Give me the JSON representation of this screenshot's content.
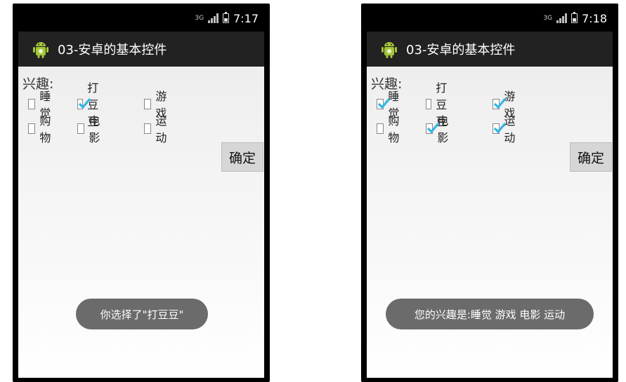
{
  "left": {
    "status": {
      "network": "3G",
      "time": "7:17"
    },
    "app_title": "03-安卓的基本控件",
    "interest_label": "兴趣:",
    "checkboxes": [
      {
        "label": "睡觉",
        "checked": false
      },
      {
        "label": "打豆豆",
        "checked": true
      },
      {
        "label": "游戏",
        "checked": false
      },
      {
        "label": "购物",
        "checked": false
      },
      {
        "label": "电影",
        "checked": false
      },
      {
        "label": "运动",
        "checked": false
      }
    ],
    "ok_button": "确定",
    "toast": "你选择了\"打豆豆\""
  },
  "right": {
    "status": {
      "network": "3G",
      "time": "7:18"
    },
    "app_title": "03-安卓的基本控件",
    "interest_label": "兴趣:",
    "checkboxes": [
      {
        "label": "睡觉",
        "checked": true
      },
      {
        "label": "打豆豆",
        "checked": false
      },
      {
        "label": "游戏",
        "checked": true
      },
      {
        "label": "购物",
        "checked": false
      },
      {
        "label": "电影",
        "checked": true
      },
      {
        "label": "运动",
        "checked": true
      }
    ],
    "ok_button": "确定",
    "toast": "您的兴趣是:睡觉 游戏 电影 运动"
  },
  "colors": {
    "check_accent": "#33b5e5",
    "action_bar": "#222222",
    "toast_bg": "#6b6b6b",
    "android_green": "#a4c639"
  },
  "icons": [
    "android-robot-icon",
    "signal-icon",
    "battery-icon",
    "checkmark-icon"
  ]
}
